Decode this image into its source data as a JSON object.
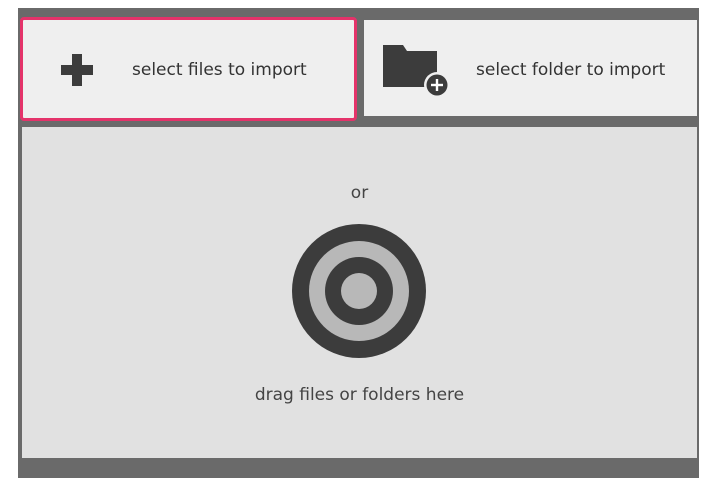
{
  "import_panel": {
    "select_files_label": "select files to import",
    "select_folder_label": "select folder to import",
    "select_files_icon": "plus-icon",
    "select_folder_icon": "folder-add-icon"
  },
  "dropzone": {
    "or_text": "or",
    "drag_text": "drag files or folders here",
    "icon": "target-icon"
  },
  "colors": {
    "frame": "#6a6a6a",
    "button_bg": "#efefef",
    "dropzone_bg": "#e1e1e1",
    "focus_border": "#e4336a",
    "icon_dark": "#3c3c3c",
    "icon_light": "#b8b8b8"
  }
}
